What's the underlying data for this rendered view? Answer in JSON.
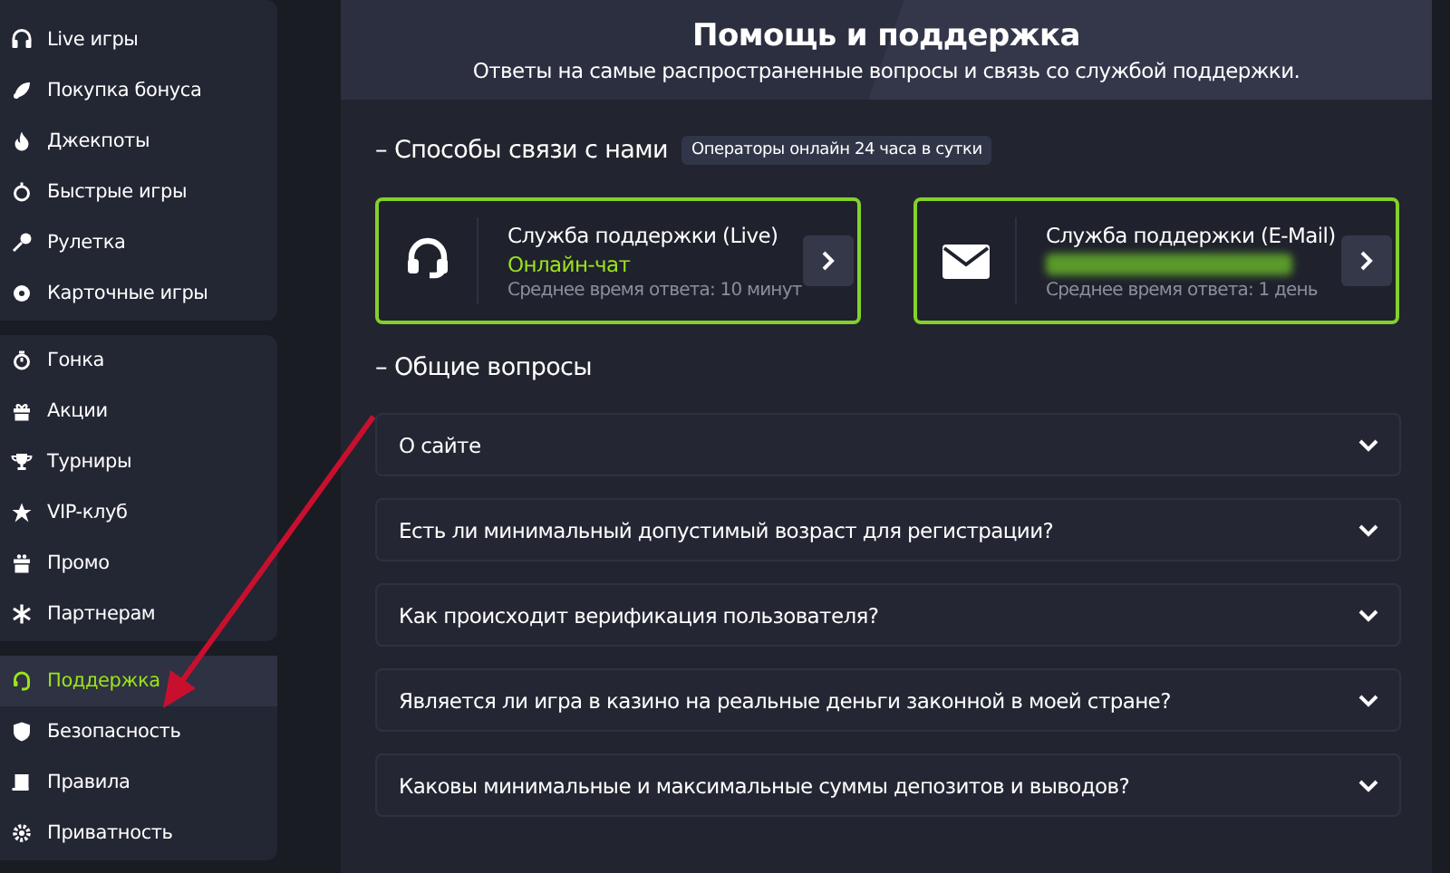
{
  "sidebar": {
    "groups": [
      {
        "items": [
          {
            "label": "Live игры",
            "selected": false
          },
          {
            "label": "Покупка бонуса",
            "selected": false
          },
          {
            "label": "Джекпоты",
            "selected": false
          },
          {
            "label": "Быстрые игры",
            "selected": false
          },
          {
            "label": "Рулетка",
            "selected": false
          },
          {
            "label": "Карточные игры",
            "selected": false
          }
        ]
      },
      {
        "items": [
          {
            "label": "Гонка",
            "selected": false
          },
          {
            "label": "Акции",
            "selected": false
          },
          {
            "label": "Турниры",
            "selected": false
          },
          {
            "label": "VIP-клуб",
            "selected": false
          },
          {
            "label": "Промо",
            "selected": false
          },
          {
            "label": "Партнерам",
            "selected": false
          }
        ]
      },
      {
        "items": [
          {
            "label": "Поддержка",
            "selected": true
          },
          {
            "label": "Безопасность",
            "selected": false
          },
          {
            "label": "Правила",
            "selected": false
          },
          {
            "label": "Приватность",
            "selected": false
          }
        ]
      }
    ]
  },
  "header": {
    "title": "Помощь и поддержка",
    "subtitle": "Ответы на самые распространенные вопросы и связь со службой поддержки."
  },
  "contact": {
    "heading": "– Способы связи с нами",
    "badge": "Операторы онлайн 24 часа в сутки",
    "cards": [
      {
        "kind": "chat",
        "title": "Служба поддержки (Live)",
        "value": "Онлайн-чат",
        "note": "Среднее время ответа: 10 минут"
      },
      {
        "kind": "email",
        "title": "Служба поддержки (E-Mail)",
        "note": "Среднее время ответа: 1 день"
      }
    ]
  },
  "faq": {
    "heading": "– Общие вопросы",
    "items": [
      {
        "question": "О сайте",
        "expanded": false
      },
      {
        "question": "Есть ли минимальный допустимый возраст для регистрации?",
        "expanded": false
      },
      {
        "question": "Как происходит верификация пользователя?",
        "expanded": false
      },
      {
        "question": "Является ли игра в казино на реальные деньги законной в моей стране?",
        "expanded": false
      },
      {
        "question": "Каковы минимальные и максимальные суммы депозитов и выводов?",
        "expanded": false
      }
    ]
  }
}
